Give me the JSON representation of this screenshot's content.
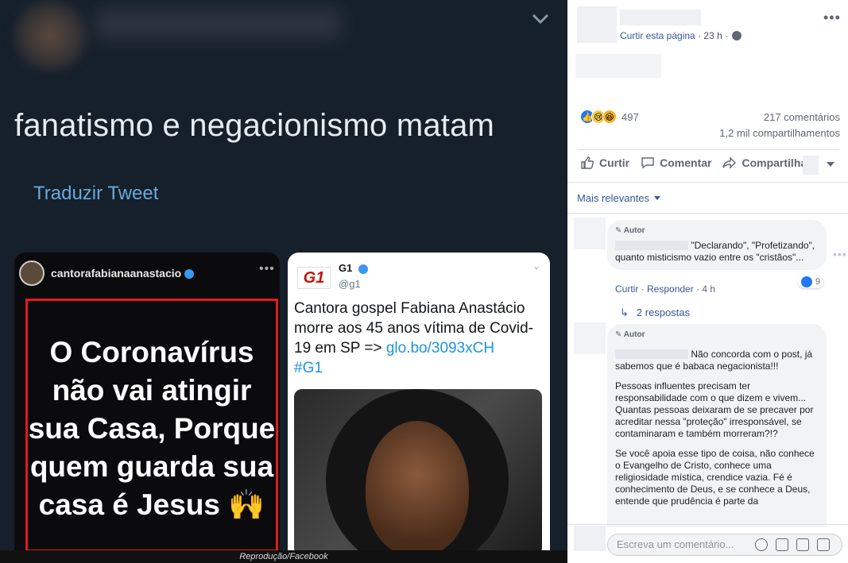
{
  "tweet": {
    "text": "fanatismo e negacionismo matam",
    "translate": "Traduzir Tweet"
  },
  "insta": {
    "username": "cantorafabianaanastacio",
    "quote": "O Coronavírus não vai atingir sua Casa, Porque quem guarda sua casa é Jesus 🙌"
  },
  "g1": {
    "logo": "G1",
    "name": "G1",
    "handle": "@g1",
    "text": "Cantora gospel Fabiana Anastácio morre aos 45 anos vítima de Covid-19 em SP => ",
    "link": "glo.bo/3093xCH",
    "hashtag": "#G1"
  },
  "caption": "Reprodução/Facebook",
  "fb": {
    "page_like": "Curtir esta página",
    "time": "· 23 h ·",
    "reaction_count": "497",
    "comments": "217 comentários",
    "shares": "1,2 mil compartilhamentos",
    "actions": {
      "like": "Curtir",
      "comment": "Comentar",
      "share": "Compartilhar"
    },
    "filter": "Mais relevantes",
    "comment1": {
      "author_tag": "Autor",
      "text": "\"Declarando\", \"Profetizando\", quanto misticismo vazio entre os \"cristãos\"...",
      "like": "Curtir",
      "reply": "Responder",
      "time": "4 h",
      "likes": "9"
    },
    "replies": "2 respostas",
    "comment2": {
      "author_tag": "Autor",
      "p1": "Não concorda com o post, já sabemos que é babaca negacionista!!!",
      "p2": "Pessoas influentes precisam ter responsabilidade com o que dizem e vivem... Quantas pessoas deixaram de se precaver por acreditar nessa \"proteção\" irresponsável, se contaminaram e também morreram?!?",
      "p3": "Se você apoia esse tipo de coisa, não conhece o Evangelho de Cristo, conhece uma religiosidade mística, crendice vazia. Fé é conhecimento de Deus, e se conhece a Deus, entende que prudência é parte da"
    },
    "write_placeholder": "Escreva um comentário..."
  },
  "colors": {
    "twitter_bg": "#15202b",
    "fb_link": "#385898",
    "highlight_border": "#e01b1b"
  }
}
